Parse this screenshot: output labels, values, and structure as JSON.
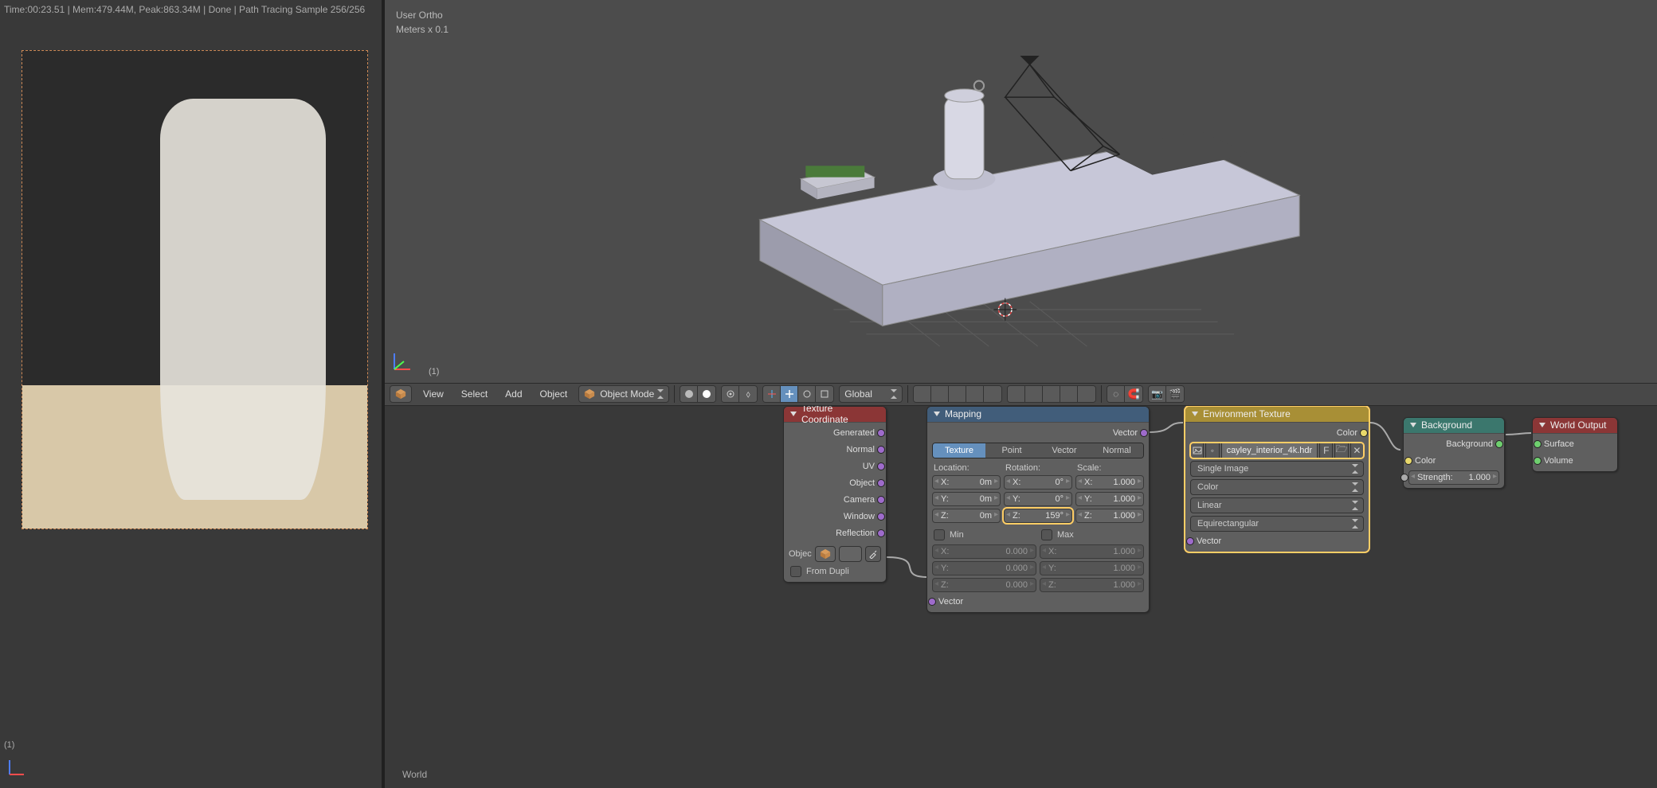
{
  "render": {
    "status": "Time:00:23.51 | Mem:479.44M, Peak:863.34M | Done | Path Tracing Sample 256/256",
    "frame_label": "(1)"
  },
  "viewport": {
    "view_name": "User Ortho",
    "units": "Meters x 0.1",
    "frame_label": "(1)"
  },
  "header": {
    "menu": {
      "view": "View",
      "select": "Select",
      "add": "Add",
      "object": "Object"
    },
    "mode": "Object Mode",
    "orientation": "Global"
  },
  "node_editor": {
    "breadcrumb": "World"
  },
  "nodes": {
    "tex_coord": {
      "title": "Texture Coordinate",
      "outputs": [
        "Generated",
        "Normal",
        "UV",
        "Object",
        "Camera",
        "Window",
        "Reflection"
      ],
      "object_label": "Objec",
      "from_dupli": "From Dupli"
    },
    "mapping": {
      "title": "Mapping",
      "out": "Vector",
      "tabs": [
        "Texture",
        "Point",
        "Vector",
        "Normal"
      ],
      "section_labels": {
        "loc": "Location:",
        "rot": "Rotation:",
        "scale": "Scale:"
      },
      "loc": {
        "x": "0m",
        "y": "0m",
        "z": "0m"
      },
      "rot": {
        "x": "0°",
        "y": "0°",
        "z": "159°"
      },
      "scale": {
        "x": "1.000",
        "y": "1.000",
        "z": "1.000"
      },
      "min_label": "Min",
      "max_label": "Max",
      "min": {
        "x": "0.000",
        "y": "0.000",
        "z": "0.000"
      },
      "max": {
        "x": "1.000",
        "y": "1.000",
        "z": "1.000"
      },
      "in": "Vector"
    },
    "env_tex": {
      "title": "Environment Texture",
      "color_out": "Color",
      "filename": "cayley_interior_4k.hdr",
      "f_label": "F",
      "source": "Single Image",
      "colorspace": "Color",
      "interp": "Linear",
      "projection": "Equirectangular",
      "vector_in": "Vector"
    },
    "background": {
      "title": "Background",
      "out": "Background",
      "color": "Color",
      "strength_label": "Strength:",
      "strength": "1.000"
    },
    "world_output": {
      "title": "World Output",
      "surface": "Surface",
      "volume": "Volume"
    }
  }
}
